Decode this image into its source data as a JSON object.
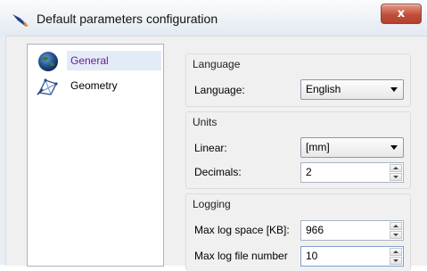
{
  "window": {
    "title": "Default parameters configuration",
    "close_symbol": "x"
  },
  "sidebar": {
    "items": [
      {
        "label": "General",
        "icon": "globe-icon",
        "selected": true
      },
      {
        "label": "Geometry",
        "icon": "geometry-icon",
        "selected": false
      }
    ]
  },
  "language": {
    "group_title": "Language",
    "label": "Language:",
    "value": "English"
  },
  "units": {
    "group_title": "Units",
    "linear_label": "Linear:",
    "linear_value": "[mm]",
    "decimals_label": "Decimals:",
    "decimals_value": "2"
  },
  "logging": {
    "group_title": "Logging",
    "max_space_label": "Max log space [KB]:",
    "max_space_value": "966",
    "max_files_label": "Max log file number",
    "max_files_value": "10"
  },
  "colors": {
    "selected_text": "#6a1b9a",
    "close_button": "#c0503b"
  }
}
